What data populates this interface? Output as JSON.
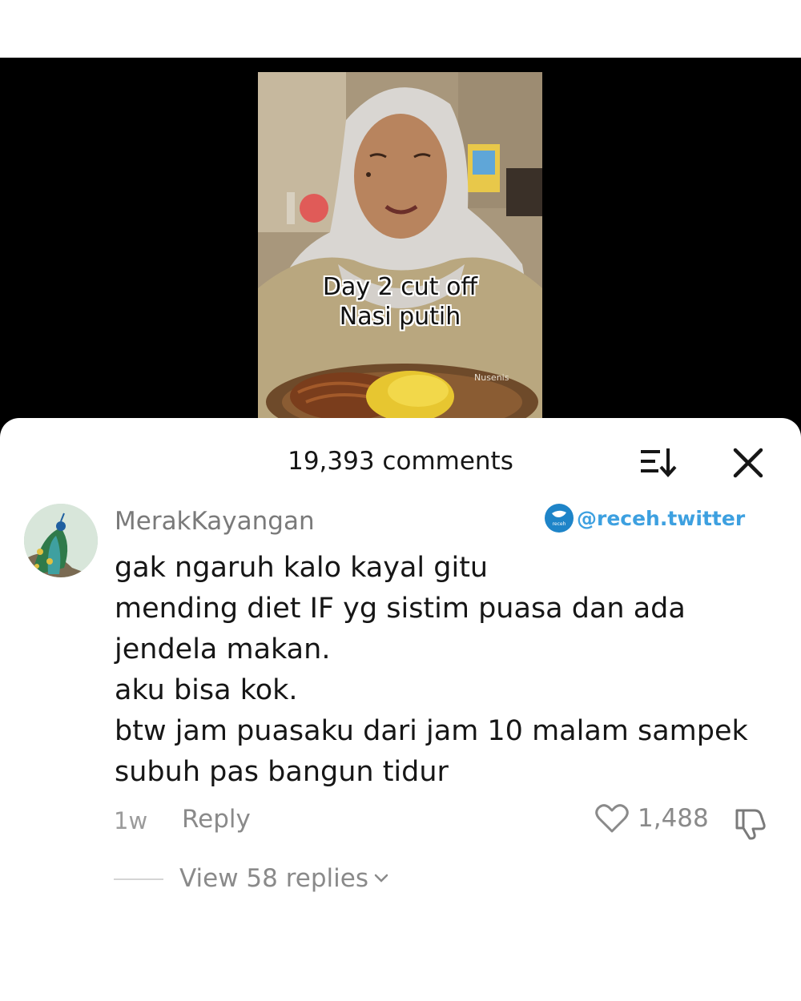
{
  "video": {
    "caption_lines": [
      "Day 2 cut off",
      "Nasi putih"
    ],
    "plate_text": "Nusenis"
  },
  "comments_header": {
    "count_label": "19,393 comments",
    "sort_icon": "sort-descending-icon",
    "close_icon": "close-icon"
  },
  "watermark": {
    "logo_text": "receh twitter",
    "handle": "@receh.twitter"
  },
  "comment": {
    "username": "MerakKayangan",
    "avatar_icon": "peacock-avatar",
    "lines": [
      "gak ngaruh kalo kayal gitu",
      "mending diet IF yg sistim puasa dan ada",
      "jendela makan.",
      "aku bisa kok.",
      "btw jam puasaku dari jam 10 malam sampek",
      "subuh pas bangun tidur"
    ],
    "time": "1w",
    "reply_label": "Reply",
    "like_count": "1,488",
    "view_replies_label": "View 58 replies"
  },
  "colors": {
    "video_background": "#000000",
    "sheet_background": "#ffffff",
    "primary_text": "#161616",
    "secondary_text": "#8a8a8a",
    "watermark_blue": "#3da0e0"
  }
}
